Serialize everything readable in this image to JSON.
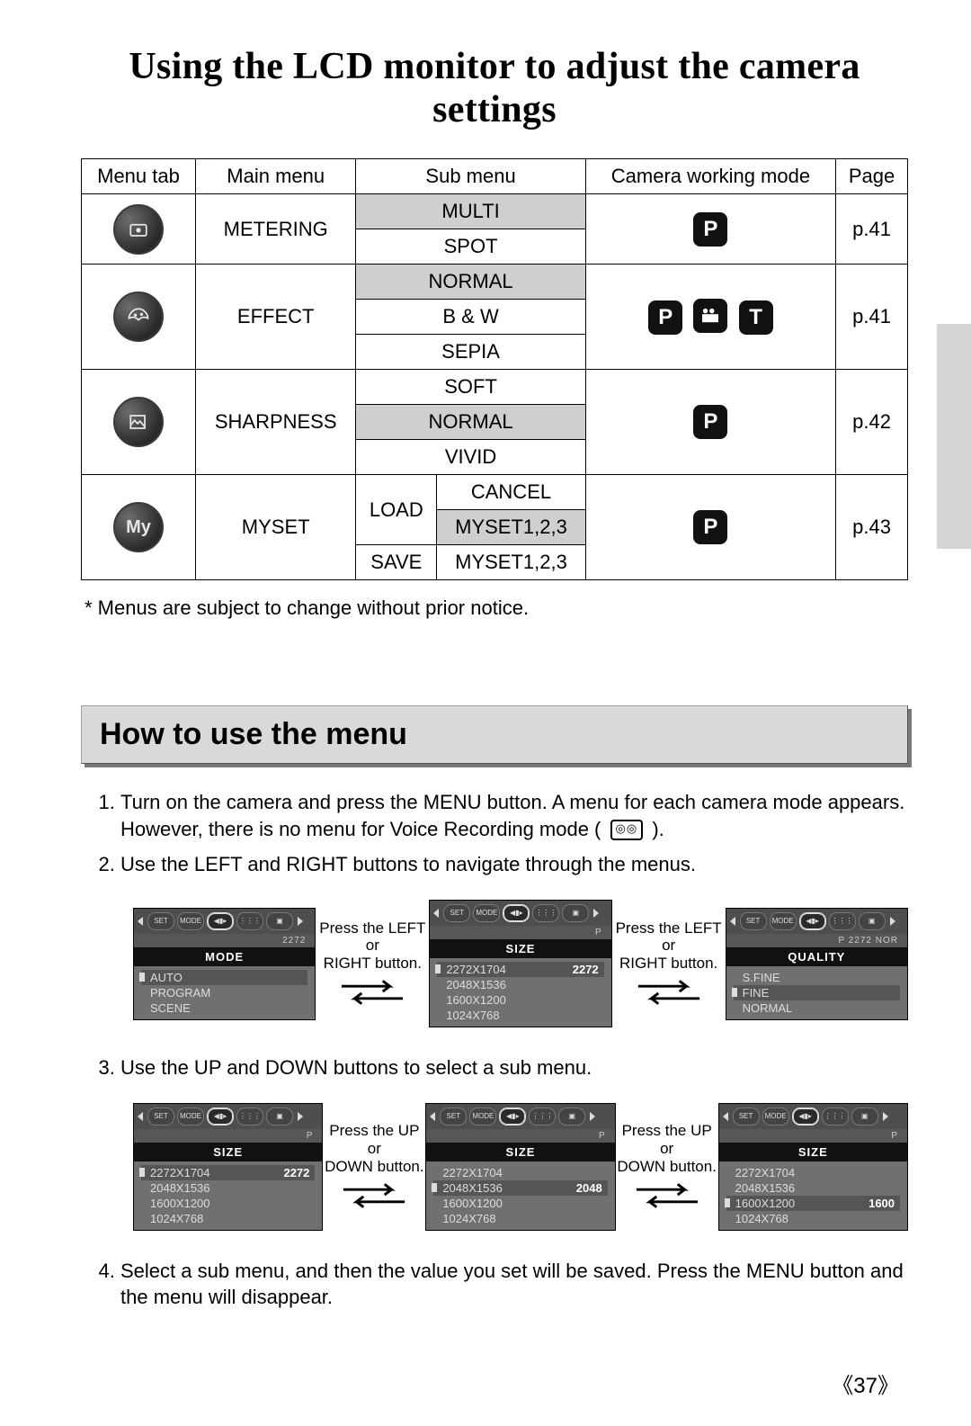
{
  "title": "Using the LCD monitor to adjust the camera settings",
  "table": {
    "headers": [
      "Menu tab",
      "Main menu",
      "Sub menu",
      "Camera working mode",
      "Page"
    ],
    "rows": [
      {
        "main": "METERING",
        "subs": [
          "MULTI",
          "SPOT"
        ],
        "shaded": [
          0
        ],
        "modes": [
          "P"
        ],
        "page": "p.41"
      },
      {
        "main": "EFFECT",
        "subs": [
          "NORMAL",
          "B & W",
          "SEPIA"
        ],
        "shaded": [
          0
        ],
        "modes": [
          "P",
          "MOVIE",
          "T"
        ],
        "page": "p.41"
      },
      {
        "main": "SHARPNESS",
        "subs": [
          "SOFT",
          "NORMAL",
          "VIVID"
        ],
        "shaded": [
          1
        ],
        "modes": [
          "P"
        ],
        "page": "p.42"
      },
      {
        "main": "MYSET",
        "subL": [
          "LOAD",
          "SAVE"
        ],
        "subR": [
          "CANCEL",
          "MYSET1,2,3",
          "MYSET1,2,3"
        ],
        "shadedR": [
          1
        ],
        "modes": [
          "P"
        ],
        "page": "p.43"
      }
    ]
  },
  "footnote": "* Menus are subject to change without prior notice.",
  "section": "How to use the menu",
  "steps": {
    "s1a": "Turn on the camera and press the MENU button. A menu for each camera mode appears. However, there is no menu for Voice Recording mode (",
    "s1b": ").",
    "s2": "Use the LEFT and RIGHT buttons to navigate through the menus.",
    "s3": "Use the UP and DOWN buttons to select a sub menu.",
    "s4": "Select a sub menu, and then the value you set will be saved. Press the MENU button and the menu will disappear."
  },
  "nav_hint_lr": "Press the LEFT or RIGHT button.",
  "nav_hint_ud": "Press the UP or DOWN button.",
  "lcd_row1": {
    "a": {
      "title": "MODE",
      "info": "2272",
      "items": [
        {
          "t": "AUTO",
          "sel": true
        },
        {
          "t": "PROGRAM"
        },
        {
          "t": "SCENE"
        }
      ]
    },
    "b": {
      "title": "SIZE",
      "info": "P",
      "items": [
        {
          "t": "2272X1704",
          "v": "2272",
          "sel": true
        },
        {
          "t": "2048X1536"
        },
        {
          "t": "1600X1200"
        },
        {
          "t": "1024X768"
        }
      ]
    },
    "c": {
      "title": "QUALITY",
      "info": "P   2272            NOR",
      "items": [
        {
          "t": "S.FINE"
        },
        {
          "t": "FINE",
          "sel": true
        },
        {
          "t": "NORMAL"
        }
      ]
    }
  },
  "lcd_row2": {
    "a": {
      "title": "SIZE",
      "info": "P",
      "items": [
        {
          "t": "2272X1704",
          "v": "2272",
          "sel": true
        },
        {
          "t": "2048X1536"
        },
        {
          "t": "1600X1200"
        },
        {
          "t": "1024X768"
        }
      ]
    },
    "b": {
      "title": "SIZE",
      "info": "P",
      "items": [
        {
          "t": "2272X1704"
        },
        {
          "t": "2048X1536",
          "v": "2048",
          "sel": true
        },
        {
          "t": "1600X1200"
        },
        {
          "t": "1024X768"
        }
      ]
    },
    "c": {
      "title": "SIZE",
      "info": "P",
      "items": [
        {
          "t": "2272X1704"
        },
        {
          "t": "2048X1536"
        },
        {
          "t": "1600X1200",
          "v": "1600",
          "sel": true
        },
        {
          "t": "1024X768"
        }
      ]
    }
  },
  "page_number": "37"
}
